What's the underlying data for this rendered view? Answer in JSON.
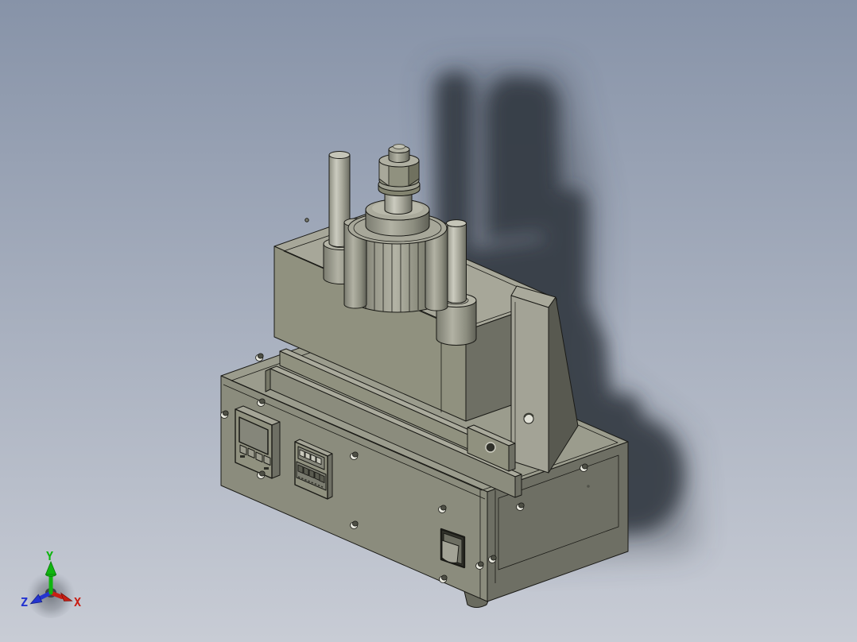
{
  "viewport": {
    "name": "3D CAD viewport with shaded machine model",
    "background_top": "#8793a8",
    "background_bottom": "#c8ccd5"
  },
  "model": {
    "face_top_color": "#9b9c8d",
    "face_front_color": "#8b8c7d",
    "face_side_color": "#6e6f64",
    "upper_top_color": "#a7a799",
    "upper_front_color": "#90917f",
    "edge_color": "#1a1a16",
    "shadow_color": "#2e343c"
  },
  "axis_triad": {
    "x": {
      "label": "X",
      "color": "#c81e14"
    },
    "y": {
      "label": "Y",
      "color": "#10b510"
    },
    "z": {
      "label": "Z",
      "color": "#2434d0"
    }
  }
}
